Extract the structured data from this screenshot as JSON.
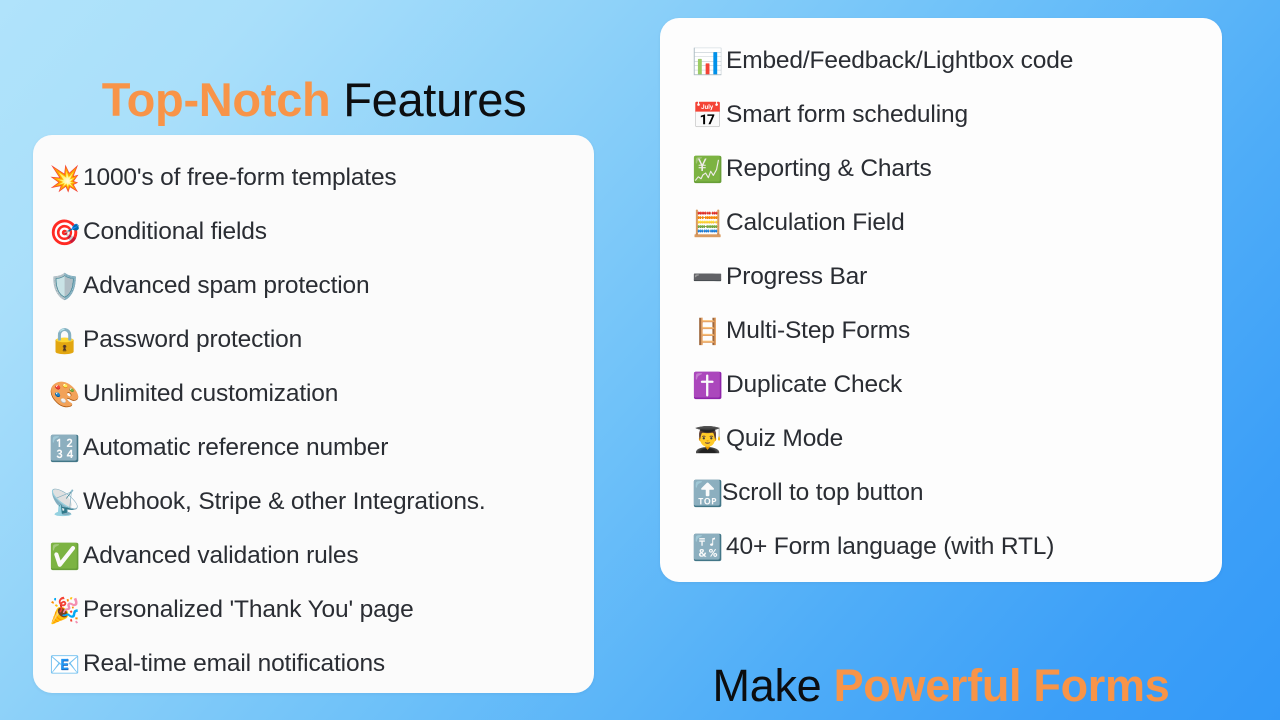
{
  "slide": {
    "background_gradient_from": "#b0e3fb",
    "background_gradient_to": "#3399f8",
    "accent_color": "#f89448",
    "text_color": "#2a2d33",
    "card_color": "#fbfbfb"
  },
  "left_heading": {
    "accent": "Top-Notch",
    "space": " ",
    "plain": "Features"
  },
  "bottom_heading": {
    "plain": "Make",
    "space": " ",
    "accent": "Powerful Forms"
  },
  "left_card": {
    "items": [
      {
        "icon": "collision-icon",
        "emoji": "💥",
        "label": "1000's of free-form templates"
      },
      {
        "icon": "direct-hit-icon",
        "emoji": "🎯",
        "label": "Conditional fields"
      },
      {
        "icon": "shield-icon",
        "emoji": "🛡️",
        "label": "Advanced spam protection"
      },
      {
        "icon": "lock-icon",
        "emoji": "🔒",
        "label": "Password protection"
      },
      {
        "icon": "artist-palette-icon",
        "emoji": "🎨",
        "label": "Unlimited customization"
      },
      {
        "icon": "input-numbers-icon",
        "emoji": "🔢",
        "label": "Automatic reference number"
      },
      {
        "icon": "satellite-antenna-icon",
        "emoji": "📡",
        "label": "Webhook, Stripe & other Integrations."
      },
      {
        "icon": "check-mark-button-icon",
        "emoji": "✅",
        "label": "Advanced validation rules"
      },
      {
        "icon": "party-popper-icon",
        "emoji": "🎉",
        "label": "Personalized 'Thank You' page"
      },
      {
        "icon": "email-icon",
        "emoji": "📧",
        "label": "Real-time email notifications"
      }
    ]
  },
  "right_card": {
    "items": [
      {
        "icon": "bar-chart-icon",
        "emoji": "📊",
        "label": "Embed/Feedback/Lightbox code"
      },
      {
        "icon": "calendar-icon",
        "emoji": "📅",
        "label": "Smart form scheduling"
      },
      {
        "icon": "chart-increasing-yen-icon",
        "emoji": "💹",
        "label": "Reporting & Charts"
      },
      {
        "icon": "abacus-icon",
        "emoji": "🧮",
        "label": "Calculation Field"
      },
      {
        "icon": "heavy-minus-sign-icon",
        "emoji": "➖",
        "label": "Progress Bar"
      },
      {
        "icon": "ladder-icon",
        "emoji": "🪜",
        "label": "Multi-Step Forms"
      },
      {
        "icon": "latin-cross-icon",
        "emoji": "✝️",
        "label": "Duplicate Check"
      },
      {
        "icon": "student-icon",
        "emoji": "👨‍🎓",
        "label": "Quiz Mode"
      },
      {
        "icon": "top-arrow-icon",
        "emoji": "🔝",
        "label": "Scroll to top button"
      },
      {
        "icon": "input-symbols-icon",
        "emoji": "🔣",
        "label": "40+ Form language (with RTL)"
      }
    ]
  }
}
